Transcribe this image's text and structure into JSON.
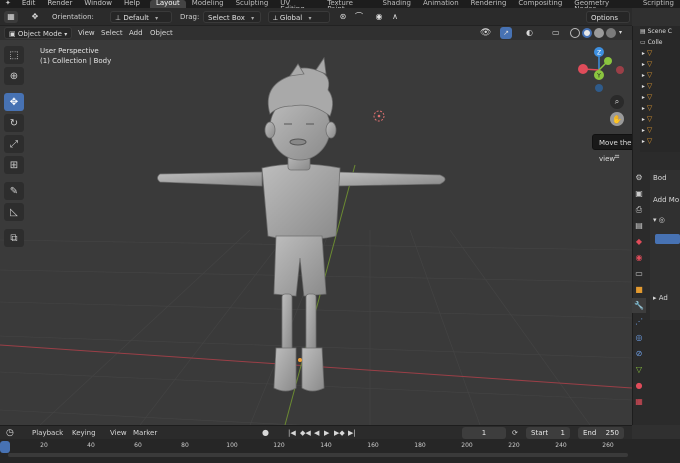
{
  "menubar": {
    "menus": [
      "Edit",
      "Render",
      "Window",
      "Help"
    ],
    "workspaces": [
      "Layout",
      "Modeling",
      "Sculpting",
      "UV Editing",
      "Texture Paint",
      "Shading",
      "Animation",
      "Rendering",
      "Compositing",
      "Geometry Nodes",
      "Scripting"
    ],
    "active_workspace": "Layout"
  },
  "toolbar": {
    "orientation_label": "Orientation:",
    "orientation_value": "Default",
    "drag_label": "Drag:",
    "drag_value": "Select Box",
    "transform_value": "Global",
    "options_label": "Options"
  },
  "viewport_header": {
    "mode": "Object Mode",
    "menus": [
      "View",
      "Select",
      "Add",
      "Object"
    ]
  },
  "viewport": {
    "perspective": "User Perspective",
    "collection": "(1) Collection | Body",
    "tooltip": "Move the view"
  },
  "gizmo": {
    "z": "Z",
    "y": "Y",
    "x": "X"
  },
  "outliner": {
    "rows": [
      "Scene C",
      "Colle",
      "",
      "",
      "",
      "",
      "",
      "",
      "",
      "",
      "",
      ""
    ]
  },
  "properties": {
    "object_name": "Bod",
    "add_modifier": "Add Mo",
    "add_label": "Ad"
  },
  "timeline": {
    "menus": [
      "Playback",
      "Keying",
      "View",
      "Marker"
    ],
    "current_frame": "1",
    "start_label": "Start",
    "start_value": "1",
    "end_label": "End",
    "end_value": "250",
    "ticks": [
      "20",
      "40",
      "60",
      "80",
      "100",
      "120",
      "140",
      "160",
      "180",
      "200",
      "220",
      "240",
      "260"
    ]
  },
  "colors": {
    "accent": "#4772b3",
    "x_axis": "#e04c5a",
    "y_axis": "#8bc53f",
    "z_axis": "#3d8fe0",
    "outliner_icon": "#e39a2f"
  }
}
